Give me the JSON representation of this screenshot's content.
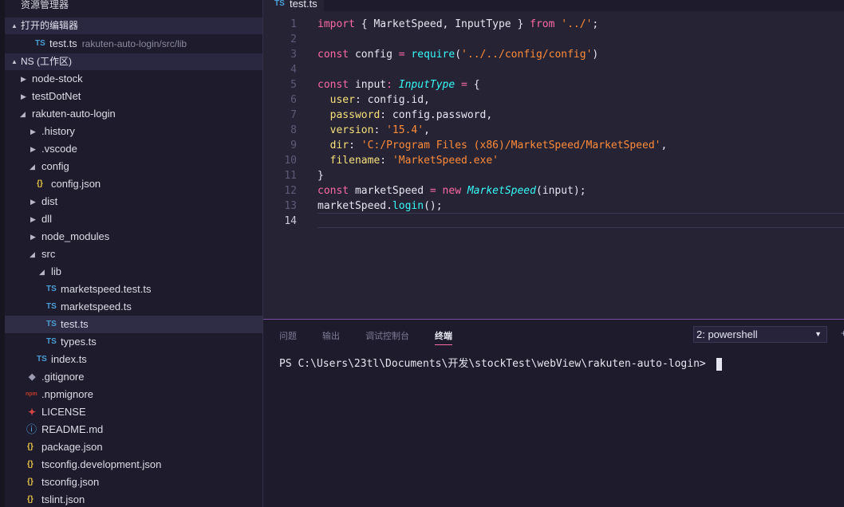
{
  "sidebar": {
    "title": "资源管理器",
    "open_editors_header": "打开的编辑器",
    "open_editor": {
      "icon": "TS",
      "name": "test.ts",
      "path": "rakuten-auto-login/src/lib"
    },
    "workspace_header": "NS (工作区)",
    "tree": [
      {
        "label": "node-stock",
        "icon": ""
      },
      {
        "label": "testDotNet",
        "icon": ""
      },
      {
        "label": "rakuten-auto-login",
        "icon": ""
      },
      {
        "label": ".history",
        "icon": ""
      },
      {
        "label": ".vscode",
        "icon": ""
      },
      {
        "label": "config",
        "icon": ""
      },
      {
        "label": "config.json",
        "icon": "{}"
      },
      {
        "label": "dist",
        "icon": ""
      },
      {
        "label": "dll",
        "icon": ""
      },
      {
        "label": "node_modules",
        "icon": ""
      },
      {
        "label": "src",
        "icon": ""
      },
      {
        "label": "lib",
        "icon": ""
      },
      {
        "label": "marketspeed.test.ts",
        "icon": "TS"
      },
      {
        "label": "marketspeed.ts",
        "icon": "TS"
      },
      {
        "label": "test.ts",
        "icon": "TS"
      },
      {
        "label": "types.ts",
        "icon": "TS"
      },
      {
        "label": "index.ts",
        "icon": "TS"
      },
      {
        "label": ".gitignore",
        "icon": "◆"
      },
      {
        "label": ".npmignore",
        "icon": "npm"
      },
      {
        "label": "LICENSE",
        "icon": "🎗"
      },
      {
        "label": "README.md",
        "icon": "ⓘ"
      },
      {
        "label": "package.json",
        "icon": "{}"
      },
      {
        "label": "tsconfig.development.json",
        "icon": "{}"
      },
      {
        "label": "tsconfig.json",
        "icon": "{}"
      },
      {
        "label": "tslint.json",
        "icon": "{}"
      }
    ]
  },
  "editor": {
    "tab": {
      "icon": "TS",
      "name": "test.ts"
    },
    "line_numbers": [
      "1",
      "2",
      "3",
      "4",
      "5",
      "6",
      "7",
      "8",
      "9",
      "10",
      "11",
      "12",
      "13",
      "14"
    ],
    "code": {
      "l1": {
        "a": "import",
        "b": " { MarketSpeed, InputType } ",
        "c": "from",
        "d": " ",
        "e": "'../'",
        "f": ";"
      },
      "l3": {
        "a": "const",
        "b": " config ",
        "c": "=",
        "d": " ",
        "e": "require",
        "f": "(",
        "g": "'../../config/config'",
        "h": ")"
      },
      "l5": {
        "a": "const",
        "b": " input",
        "c": ":",
        "d": " ",
        "e": "InputType",
        "f": " ",
        "g": "=",
        "h": " {"
      },
      "l6": {
        "a": "  user",
        "b": ": config.id,"
      },
      "l7": {
        "a": "  password",
        "b": ": config.password,"
      },
      "l8": {
        "a": "  version",
        "b": ": ",
        "c": "'15.4'",
        "d": ","
      },
      "l9": {
        "a": "  dir",
        "b": ": ",
        "c": "'C:/Program Files (x86)/MarketSpeed/MarketSpeed'",
        "d": ","
      },
      "l10": {
        "a": "  filename",
        "b": ": ",
        "c": "'MarketSpeed.exe'"
      },
      "l11": {
        "a": "}"
      },
      "l12": {
        "a": "const",
        "b": " marketSpeed ",
        "c": "=",
        "d": " ",
        "e": "new",
        "f": " ",
        "g": "MarketSpeed",
        "h": "(input);"
      },
      "l13": {
        "a": "marketSpeed.",
        "b": "login",
        "c": "();"
      }
    }
  },
  "panel": {
    "tabs": [
      "问题",
      "输出",
      "调试控制台",
      "终端"
    ],
    "active_tab": "终端",
    "terminal_select": "2: powershell",
    "terminal_prompt": "PS C:\\Users\\23tl\\Documents\\开发\\stockTest\\webView\\rakuten-auto-login> "
  },
  "colors": {
    "background": "#262335",
    "sidebar": "#1e1c2c",
    "keyword": "#fe6aa4",
    "string": "#ff8b39",
    "type": "#36f9f6",
    "property": "#f7e07a",
    "accent": "#7a4ea0"
  }
}
